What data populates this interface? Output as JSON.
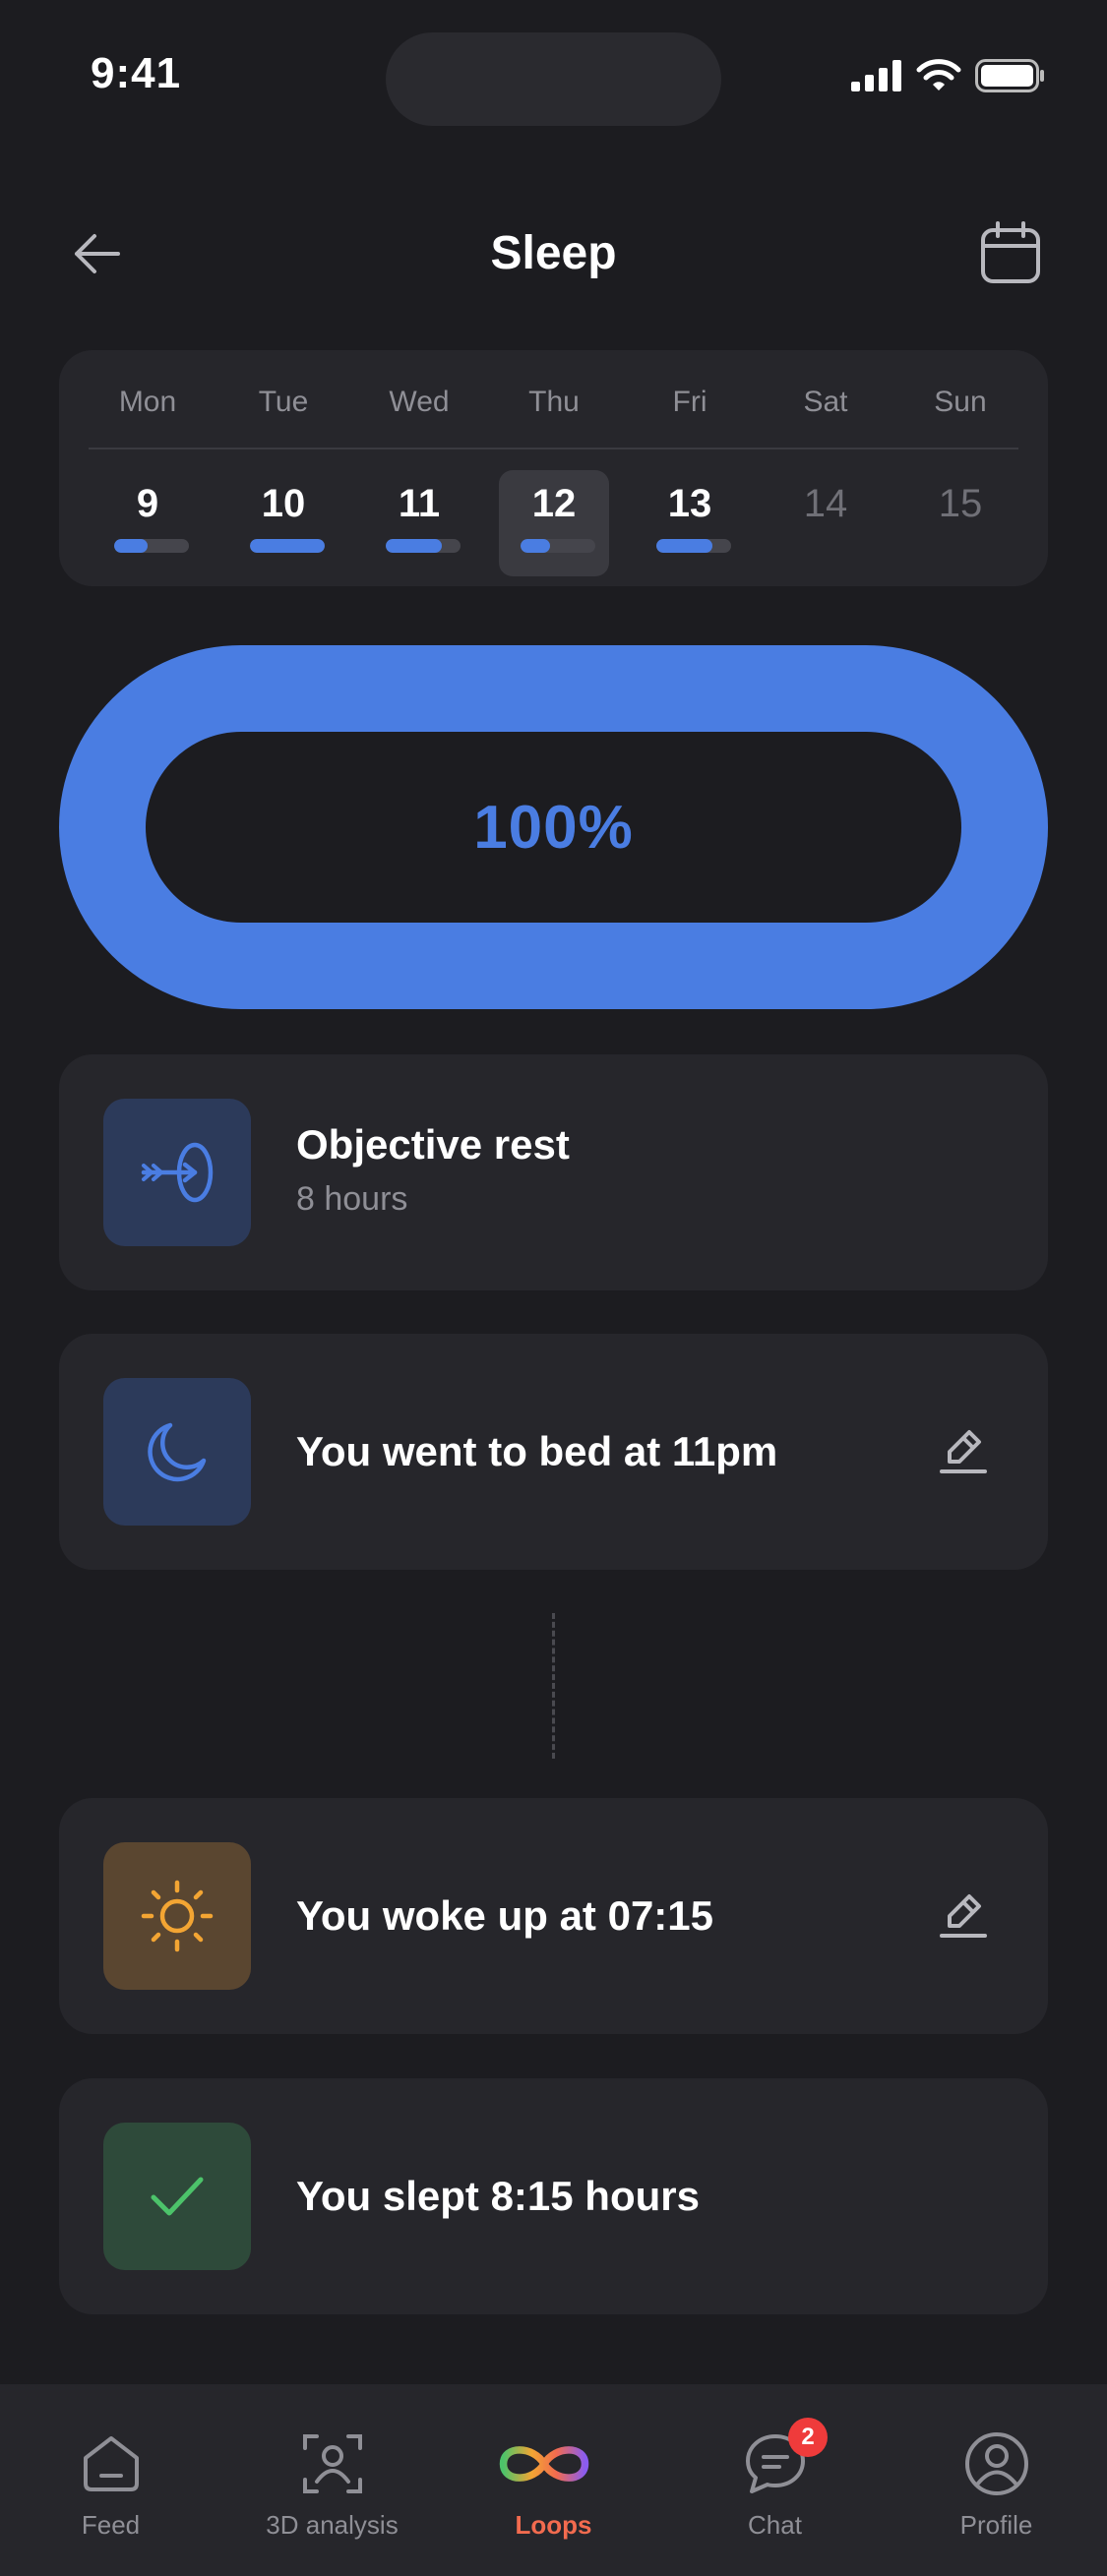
{
  "status_bar": {
    "time": "9:41"
  },
  "header": {
    "title": "Sleep"
  },
  "week": {
    "days": [
      {
        "name": "Mon",
        "num": "9",
        "progress": 0.45,
        "active": true,
        "selected": false
      },
      {
        "name": "Tue",
        "num": "10",
        "progress": 1.0,
        "active": true,
        "selected": false
      },
      {
        "name": "Wed",
        "num": "11",
        "progress": 0.75,
        "active": true,
        "selected": false
      },
      {
        "name": "Thu",
        "num": "12",
        "progress": 0.4,
        "active": true,
        "selected": true
      },
      {
        "name": "Fri",
        "num": "13",
        "progress": 0.75,
        "active": true,
        "selected": false
      },
      {
        "name": "Sat",
        "num": "14",
        "progress": 0,
        "active": false,
        "selected": false
      },
      {
        "name": "Sun",
        "num": "15",
        "progress": 0,
        "active": false,
        "selected": false
      }
    ]
  },
  "ring": {
    "percent_label": "100%",
    "progress": 1.0,
    "color": "#4a7de2"
  },
  "cards": {
    "objective": {
      "title": "Objective rest",
      "subtitle": "8 hours"
    },
    "bed": {
      "title": "You went to bed at 11pm"
    },
    "woke": {
      "title": "You woke up at 07:15"
    },
    "slept": {
      "title": "You slept 8:15 hours"
    }
  },
  "tabbar": {
    "tabs": [
      {
        "label": "Feed",
        "icon": "feed-icon"
      },
      {
        "label": "3D analysis",
        "icon": "scan-person-icon"
      },
      {
        "label": "Loops",
        "icon": "infinity-icon",
        "active": true
      },
      {
        "label": "Chat",
        "icon": "chat-icon",
        "badge": "2"
      },
      {
        "label": "Profile",
        "icon": "profile-icon"
      }
    ]
  },
  "colors": {
    "accent": "#4a7de2",
    "active_tab": "#f26b4f",
    "badge": "#ef3b3b",
    "success": "#4cc36a",
    "sun": "#f3a533"
  }
}
